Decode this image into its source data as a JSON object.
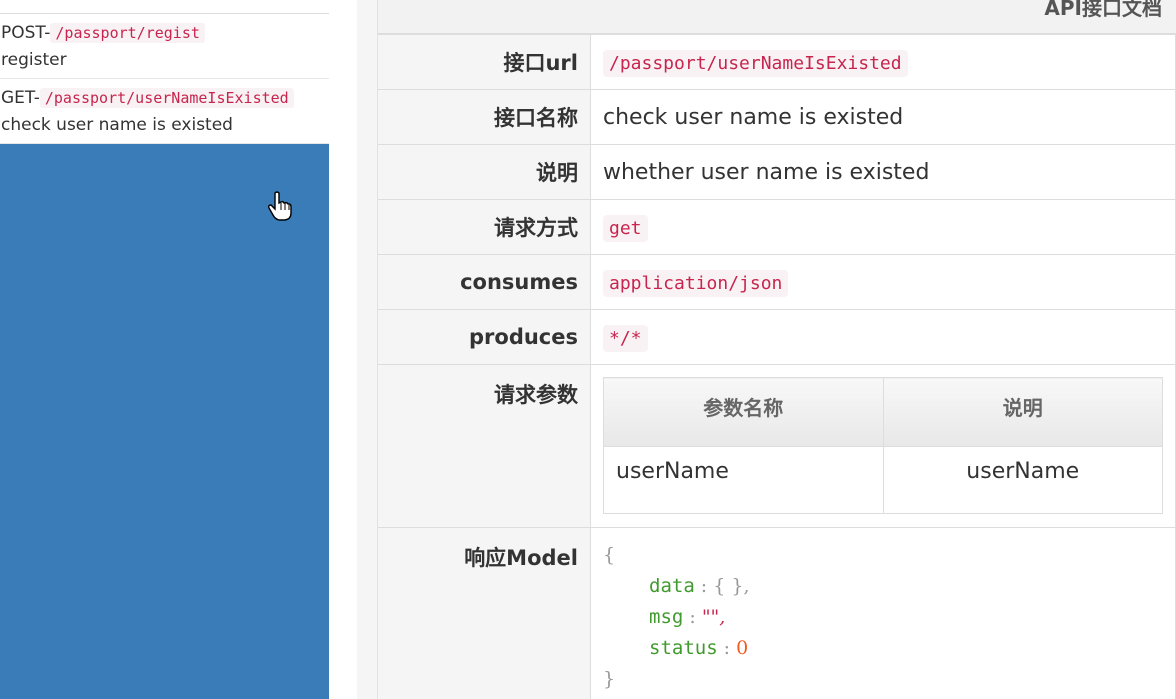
{
  "sidebar": {
    "items": [
      {
        "method": "POST-",
        "path": "/passport/regist",
        "desc": "register"
      },
      {
        "method": "GET-",
        "path": "/passport/userNameIsExisted",
        "desc": "check user name is existed"
      }
    ]
  },
  "main": {
    "title": "API接口文档",
    "rows": {
      "url_label": "接口url",
      "url_value": "/passport/userNameIsExisted",
      "name_label": "接口名称",
      "name_value": "check user name is existed",
      "desc_label": "说明",
      "desc_value": "whether user name is existed",
      "method_label": "请求方式",
      "method_value": "get",
      "consumes_label": "consumes",
      "consumes_value": "application/json",
      "produces_label": "produces",
      "produces_value": "*/*",
      "params_label": "请求参数",
      "model_label": "响应Model"
    },
    "params_table": {
      "headers": [
        "参数名称",
        "说明"
      ],
      "rows": [
        {
          "name": "userName",
          "desc": "userName"
        }
      ]
    },
    "model": {
      "open": "{",
      "lines": [
        {
          "key": "data",
          "sep": " : ",
          "val": "{ },"
        },
        {
          "key": "msg",
          "sep": " : ",
          "val": "\"\","
        },
        {
          "key": "status",
          "sep": " : ",
          "val": "0"
        }
      ],
      "close": "}"
    }
  }
}
